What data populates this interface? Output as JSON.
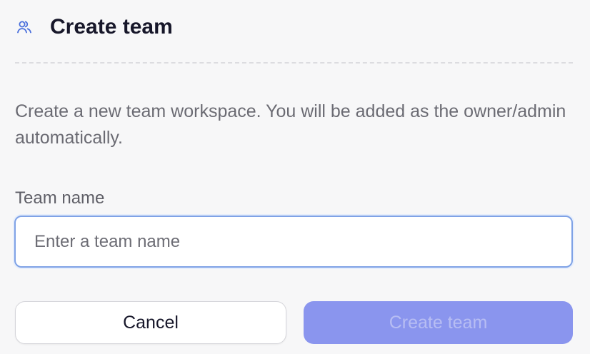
{
  "dialog": {
    "title": "Create team",
    "title_icon": "users-icon",
    "description": "Create a new team workspace. You will be added as the owner/admin automatically.",
    "field": {
      "label": "Team name",
      "placeholder": "Enter a team name",
      "value": ""
    },
    "actions": {
      "cancel_label": "Cancel",
      "submit_label": "Create team"
    }
  },
  "colors": {
    "accent": "#8a95ee",
    "icon": "#4a6fdc",
    "input_focus_border": "#7fa2e6"
  }
}
